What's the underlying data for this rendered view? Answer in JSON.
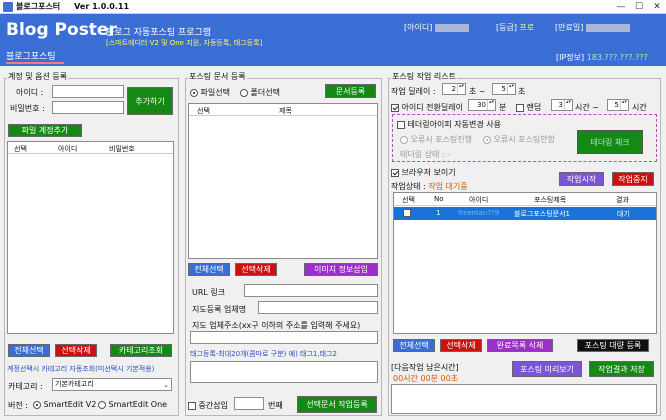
{
  "titlebar": {
    "app_name": "블로그포스터",
    "version": "Ver 1.0.0.11",
    "minimize": "—",
    "maximize": "☐",
    "close": "✕"
  },
  "header": {
    "logo": "Blog Poster",
    "subtitle": "블로그 자동포스팅 프로그램",
    "tagline": "[스마트에디터 V2 및 One 지원, 자동등록, 태그등록]",
    "id_label": "[아이디]",
    "grade_label": "[등급]",
    "grade_value": "프로",
    "expiry_label": "[만료일]",
    "tab": "블로그포스팅",
    "ip_label": "[IP정보]",
    "ip_value": "183.???.???.???"
  },
  "account": {
    "title": "계정 및 옵션 등록",
    "id_label": "아이디 :",
    "pw_label": "비밀번호 :",
    "add_button": "추가하기",
    "file_add_button": "파일 계정추가",
    "columns": [
      "선택",
      "아이디",
      "비밀번호"
    ],
    "select_all": "전체선택",
    "delete_selected": "선택삭제",
    "category_lookup": "카테고리조회",
    "category_note": "계정선택시 카테고리 자동조회(미선택시 기본적용)",
    "category_label": "카테고리 :",
    "category_value": "기본카테고리",
    "version_label": "버전 :",
    "version_v2": "SmartEdit V2",
    "version_one": "SmartEdit One"
  },
  "docs": {
    "title": "포스팅 문서 등록",
    "file_select": "파일선택",
    "folder_select": "폴더선택",
    "register_button": "문서등록",
    "columns": [
      "선택",
      "제목"
    ],
    "select_all": "전체선택",
    "delete_selected": "선택삭제",
    "image_info": "이미지 정보삽입",
    "url_label": "URL 링크",
    "map_label": "지도등록 업체명",
    "map_addr_label": "지도 업체주소(xx구 이하의 주소를 입력해 주세요)",
    "tag_note": "태그등록-최대20개(콤마로 구분) 예) 태그1,태그2",
    "mid_insert_label": "중간삽입",
    "mid_insert_unit": "번째",
    "register_posting": "선택문서 작업등록"
  },
  "tasks": {
    "title": "포스팅 작업 리스트",
    "delay_label": "작업 딜레이 :",
    "delay_from": "2",
    "delay_to": "5",
    "delay_unit": "초",
    "delay_sep": "초 ~",
    "id_switch_label": "아이디 전환딜레이",
    "id_switch_value": "30",
    "id_switch_unit": "분",
    "random_label": "랜덤",
    "random_from": "3",
    "random_to": "5",
    "hour_unit": "시간",
    "hour_sep": "시간 ~",
    "tethering_label": "테더링아이피 자동변경 사용",
    "err_continue": "오류시 포스팅진행",
    "err_stop": "오류시 포스팅안함",
    "tethering_check": "테더링 체크",
    "tethering_status": "테더링 상태 : -",
    "browser_label": "브라우저 보이기",
    "status_label": "작업상태 :",
    "status_value": "작업 대기중",
    "start_button": "작업시작",
    "stop_button": "작업중지",
    "columns": [
      "선택",
      "No",
      "아이디",
      "포스팅제목",
      "결과"
    ],
    "rows": [
      {
        "no": "1",
        "id": "freeman??9",
        "title": "블로그포스팅문서1",
        "result": "대기"
      }
    ],
    "select_all": "전체선택",
    "delete_selected": "선택삭제",
    "delete_done": "완료목록 삭제",
    "bulk_register": "포스팅 대량 등록",
    "next_label": "[다음작업 남은시간]",
    "next_value": "00시간 00분 00초",
    "preview_button": "포스팅 미리보기",
    "save_result_button": "작업결과 저장"
  },
  "colors": {
    "header_blue": "#3b6ed4",
    "green": "#148a14",
    "red": "#cc1111",
    "purple": "#9b2fc9",
    "status_orange": "#d45a00"
  }
}
